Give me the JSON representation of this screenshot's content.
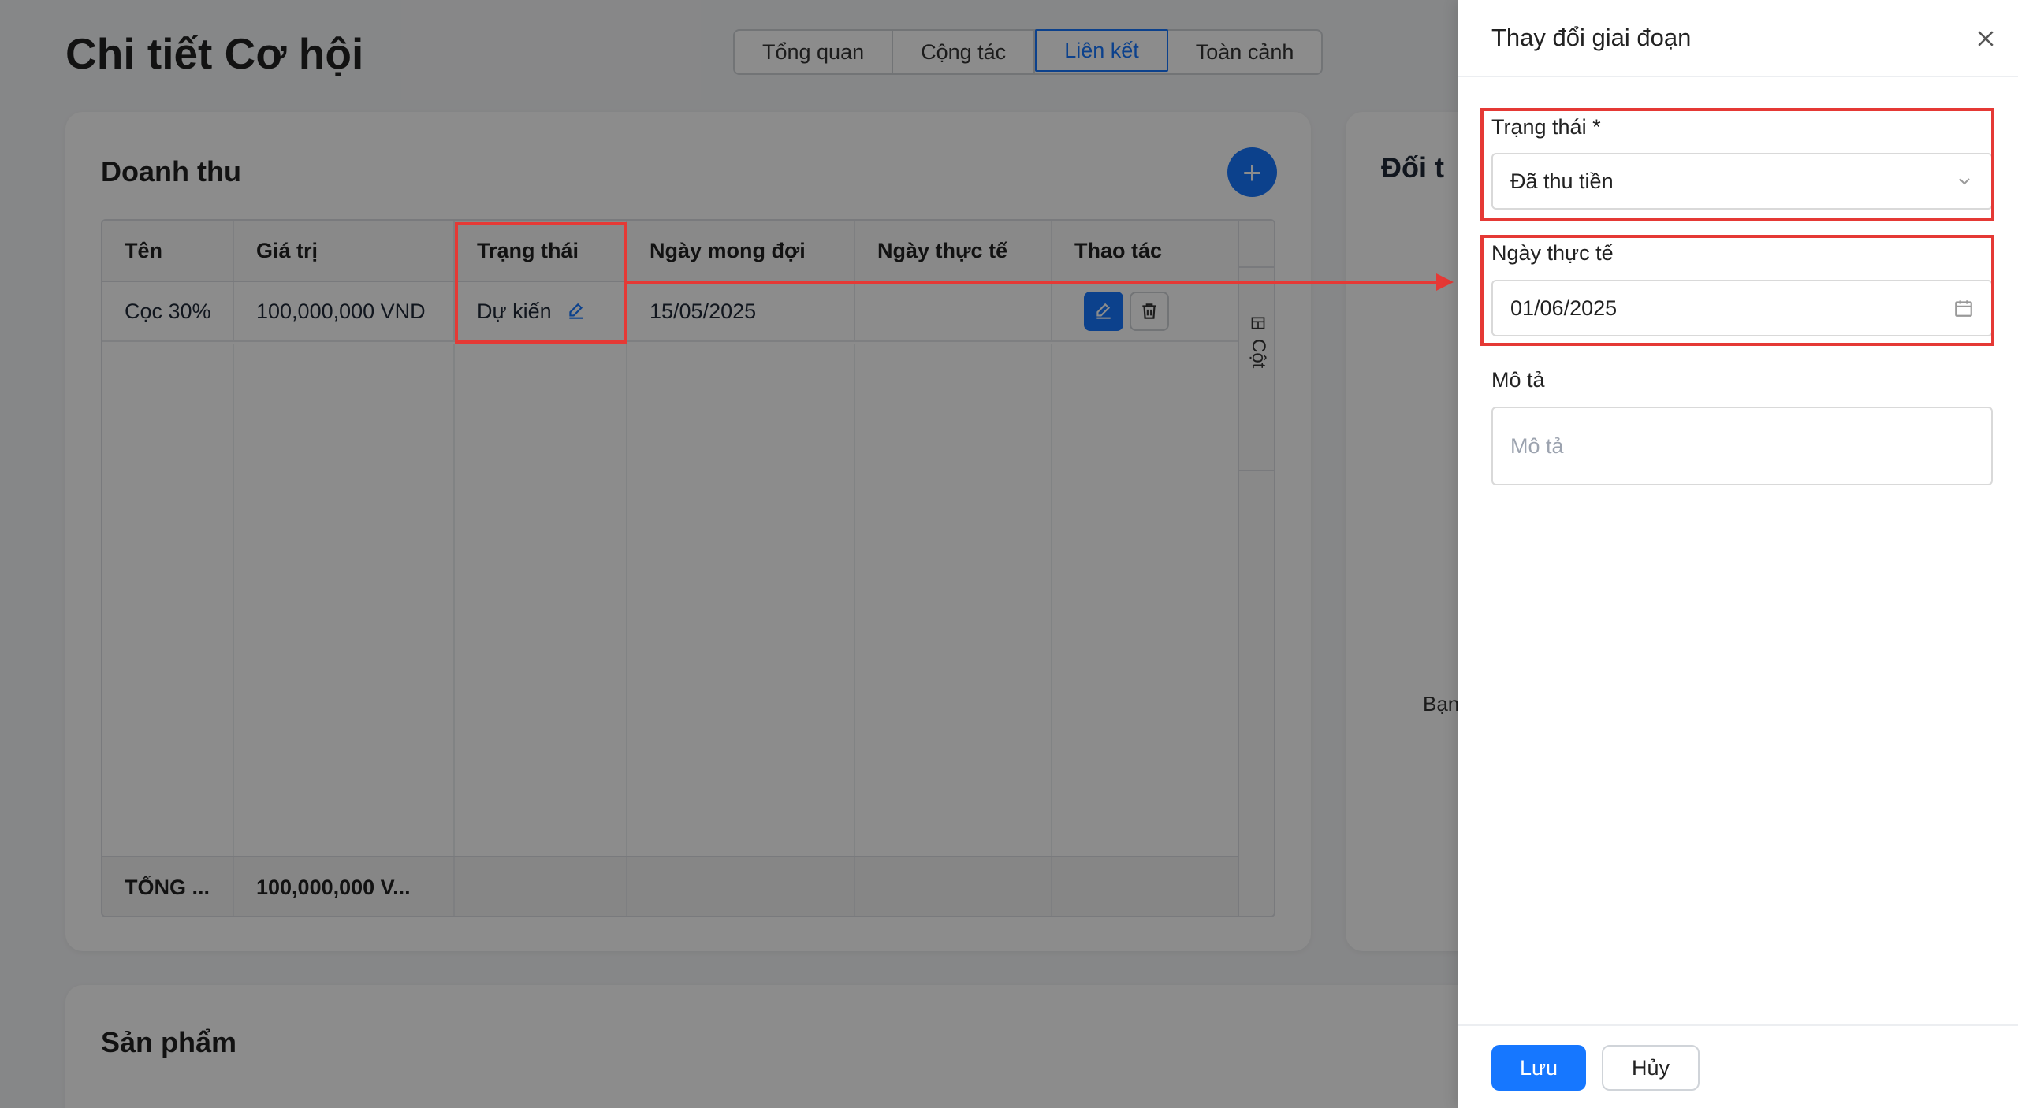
{
  "page": {
    "title": "Chi tiết Cơ hội",
    "tabs": [
      {
        "label": "Tổng quan",
        "active": false
      },
      {
        "label": "Cộng tác",
        "active": false
      },
      {
        "label": "Liên kết",
        "active": true
      },
      {
        "label": "Toàn cảnh",
        "active": false
      }
    ]
  },
  "revenue": {
    "heading": "Doanh thu",
    "add_icon": "plus-icon",
    "columns": [
      "Tên",
      "Giá trị",
      "Trạng thái",
      "Ngày mong đợi",
      "Ngày thực tế",
      "Thao tác"
    ],
    "rows": [
      {
        "name": "Cọc 30%",
        "value": "100,000,000 VND",
        "status": "Dự kiến",
        "expected_date": "15/05/2025",
        "actual_date": ""
      }
    ],
    "footer": {
      "name": "TỔNG ...",
      "value": "100,000,000 V..."
    },
    "columns_panel_label": "Cột"
  },
  "side_card": {
    "heading": "Đối t",
    "body_text": "Bạn"
  },
  "products": {
    "heading": "Sản phẩm"
  },
  "drawer": {
    "title": "Thay đổi giai đoạn",
    "status_label": "Trạng thái *",
    "status_value": "Đã thu tiền",
    "actual_date_label": "Ngày thực tế",
    "actual_date_value": "01/06/2025",
    "description_label": "Mô tả",
    "description_placeholder": "Mô tả",
    "save_label": "Lưu",
    "cancel_label": "Hủy"
  },
  "colors": {
    "primary": "#1677ff",
    "annotation": "#e53935"
  }
}
